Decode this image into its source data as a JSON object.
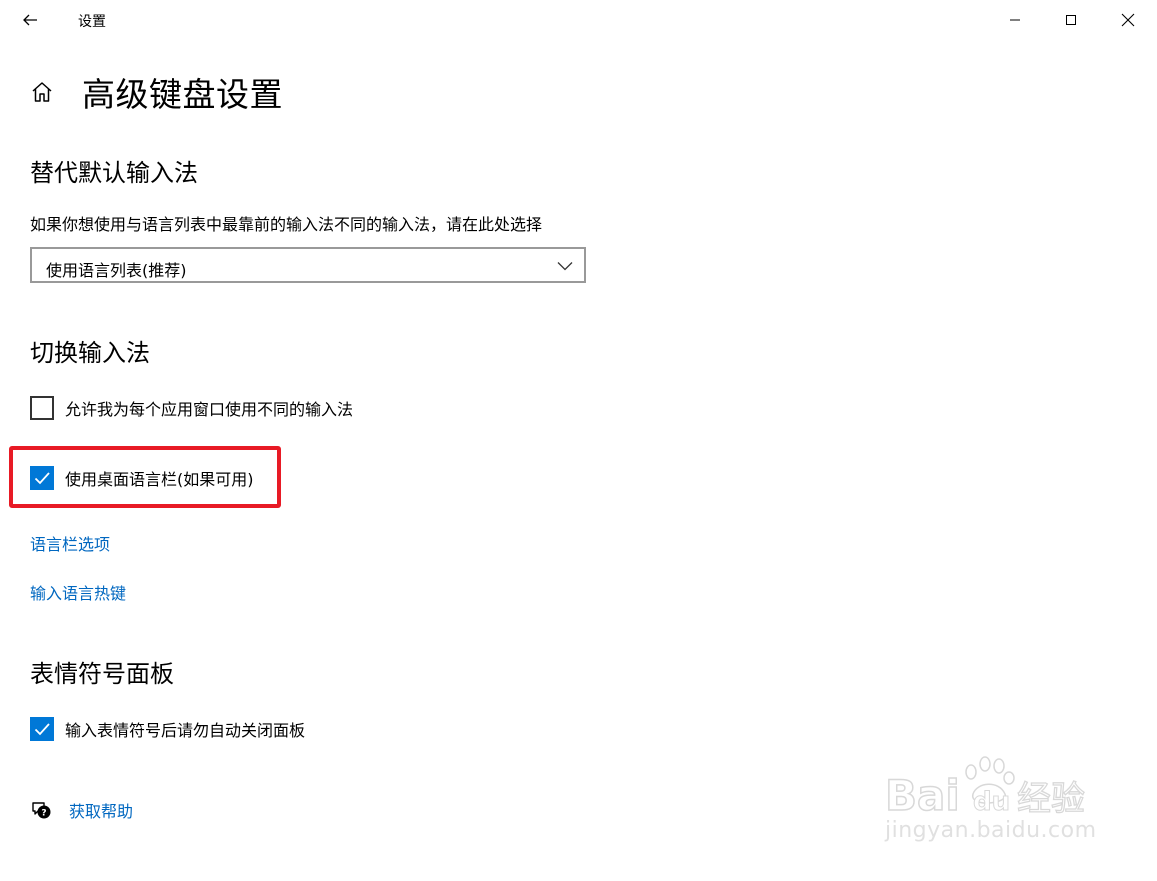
{
  "window": {
    "title": "设置"
  },
  "page": {
    "title": "高级键盘设置"
  },
  "section_ime_override": {
    "heading": "替代默认输入法",
    "description": "如果你想使用与语言列表中最靠前的输入法不同的输入法，请在此处选择",
    "dropdown_value": "使用语言列表(推荐)"
  },
  "section_switch_ime": {
    "heading": "切换输入法",
    "options": [
      {
        "label": "允许我为每个应用窗口使用不同的输入法",
        "checked": false
      },
      {
        "label": "使用桌面语言栏(如果可用)",
        "checked": true
      }
    ],
    "links": [
      "语言栏选项",
      "输入语言热键"
    ]
  },
  "section_emoji": {
    "heading": "表情符号面板",
    "options": [
      {
        "label": "输入表情符号后请勿自动关闭面板",
        "checked": true
      }
    ]
  },
  "help": {
    "label": "获取帮助"
  },
  "watermark": {
    "logo_text": "Bai du 经验",
    "url_text": "jingyan.baidu.com"
  },
  "colors": {
    "accent": "#0078d7",
    "link": "#0067c0",
    "highlight": "#e81a25"
  },
  "icons": {
    "back": "back-arrow-icon",
    "home": "home-icon",
    "minimize": "minimize-icon",
    "maximize": "maximize-icon",
    "close": "close-icon",
    "dropdown": "chevron-down-icon",
    "check": "checkmark-icon",
    "help": "help-chat-icon"
  }
}
